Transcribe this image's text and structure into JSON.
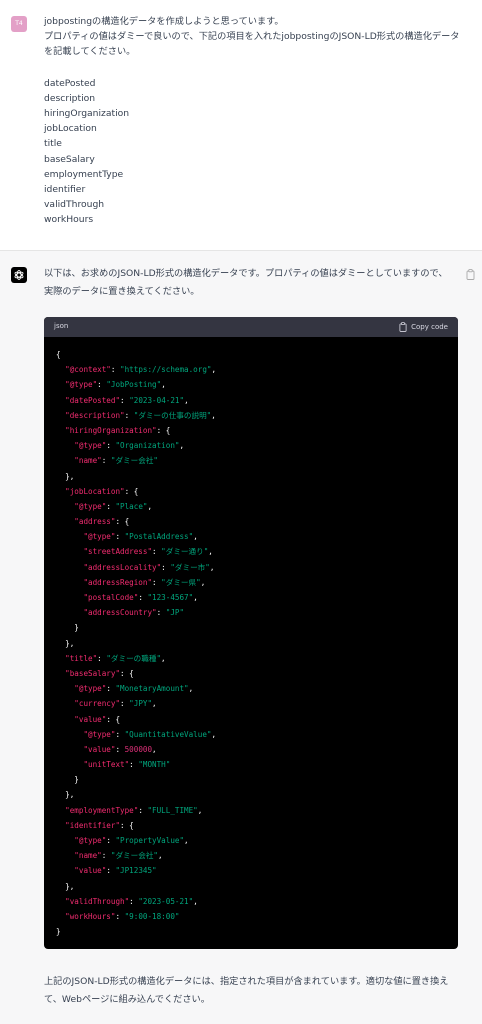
{
  "user": {
    "avatar_text": "T4",
    "message_line1": "jobpostingの構造化データを作成しようと思っています。",
    "message_line2": "プロパティの値はダミーで良いので、下記の項目を入れたjobpostingのJSON-LD形式の構造化データを記載してください。",
    "fields": [
      "datePosted",
      "description",
      "hiringOrganization",
      "jobLocation",
      "title",
      "baseSalary",
      "employmentType",
      "identifier",
      "validThrough",
      "workHours"
    ]
  },
  "assistant": {
    "intro": "以下は、お求めのJSON-LD形式の構造化データです。プロパティの値はダミーとしていますので、実際のデータに置き換えてください。",
    "code_language": "json",
    "copy_code_label": "Copy code",
    "outro": "上記のJSON-LD形式の構造化データには、指定された項目が含まれています。適切な値に置き換えて、Webページに組み込んでください。",
    "code_lines": [
      [
        {
          "t": "p",
          "v": "{"
        }
      ],
      [
        {
          "t": "p",
          "v": "  "
        },
        {
          "t": "k",
          "v": "\"@context\""
        },
        {
          "t": "p",
          "v": ": "
        },
        {
          "t": "s",
          "v": "\"https://schema.org\""
        },
        {
          "t": "p",
          "v": ","
        }
      ],
      [
        {
          "t": "p",
          "v": "  "
        },
        {
          "t": "k",
          "v": "\"@type\""
        },
        {
          "t": "p",
          "v": ": "
        },
        {
          "t": "s",
          "v": "\"JobPosting\""
        },
        {
          "t": "p",
          "v": ","
        }
      ],
      [
        {
          "t": "p",
          "v": "  "
        },
        {
          "t": "k",
          "v": "\"datePosted\""
        },
        {
          "t": "p",
          "v": ": "
        },
        {
          "t": "s",
          "v": "\"2023-04-21\""
        },
        {
          "t": "p",
          "v": ","
        }
      ],
      [
        {
          "t": "p",
          "v": "  "
        },
        {
          "t": "k",
          "v": "\"description\""
        },
        {
          "t": "p",
          "v": ": "
        },
        {
          "t": "s",
          "v": "\"ダミーの仕事の説明\""
        },
        {
          "t": "p",
          "v": ","
        }
      ],
      [
        {
          "t": "p",
          "v": "  "
        },
        {
          "t": "k",
          "v": "\"hiringOrganization\""
        },
        {
          "t": "p",
          "v": ": {"
        }
      ],
      [
        {
          "t": "p",
          "v": "    "
        },
        {
          "t": "k",
          "v": "\"@type\""
        },
        {
          "t": "p",
          "v": ": "
        },
        {
          "t": "s",
          "v": "\"Organization\""
        },
        {
          "t": "p",
          "v": ","
        }
      ],
      [
        {
          "t": "p",
          "v": "    "
        },
        {
          "t": "k",
          "v": "\"name\""
        },
        {
          "t": "p",
          "v": ": "
        },
        {
          "t": "s",
          "v": "\"ダミー会社\""
        }
      ],
      [
        {
          "t": "p",
          "v": "  },"
        }
      ],
      [
        {
          "t": "p",
          "v": "  "
        },
        {
          "t": "k",
          "v": "\"jobLocation\""
        },
        {
          "t": "p",
          "v": ": {"
        }
      ],
      [
        {
          "t": "p",
          "v": "    "
        },
        {
          "t": "k",
          "v": "\"@type\""
        },
        {
          "t": "p",
          "v": ": "
        },
        {
          "t": "s",
          "v": "\"Place\""
        },
        {
          "t": "p",
          "v": ","
        }
      ],
      [
        {
          "t": "p",
          "v": "    "
        },
        {
          "t": "k",
          "v": "\"address\""
        },
        {
          "t": "p",
          "v": ": {"
        }
      ],
      [
        {
          "t": "p",
          "v": "      "
        },
        {
          "t": "k",
          "v": "\"@type\""
        },
        {
          "t": "p",
          "v": ": "
        },
        {
          "t": "s",
          "v": "\"PostalAddress\""
        },
        {
          "t": "p",
          "v": ","
        }
      ],
      [
        {
          "t": "p",
          "v": "      "
        },
        {
          "t": "k",
          "v": "\"streetAddress\""
        },
        {
          "t": "p",
          "v": ": "
        },
        {
          "t": "s",
          "v": "\"ダミー通り\""
        },
        {
          "t": "p",
          "v": ","
        }
      ],
      [
        {
          "t": "p",
          "v": "      "
        },
        {
          "t": "k",
          "v": "\"addressLocality\""
        },
        {
          "t": "p",
          "v": ": "
        },
        {
          "t": "s",
          "v": "\"ダミー市\""
        },
        {
          "t": "p",
          "v": ","
        }
      ],
      [
        {
          "t": "p",
          "v": "      "
        },
        {
          "t": "k",
          "v": "\"addressRegion\""
        },
        {
          "t": "p",
          "v": ": "
        },
        {
          "t": "s",
          "v": "\"ダミー県\""
        },
        {
          "t": "p",
          "v": ","
        }
      ],
      [
        {
          "t": "p",
          "v": "      "
        },
        {
          "t": "k",
          "v": "\"postalCode\""
        },
        {
          "t": "p",
          "v": ": "
        },
        {
          "t": "s",
          "v": "\"123-4567\""
        },
        {
          "t": "p",
          "v": ","
        }
      ],
      [
        {
          "t": "p",
          "v": "      "
        },
        {
          "t": "k",
          "v": "\"addressCountry\""
        },
        {
          "t": "p",
          "v": ": "
        },
        {
          "t": "s",
          "v": "\"JP\""
        }
      ],
      [
        {
          "t": "p",
          "v": "    }"
        }
      ],
      [
        {
          "t": "p",
          "v": "  },"
        }
      ],
      [
        {
          "t": "p",
          "v": "  "
        },
        {
          "t": "k",
          "v": "\"title\""
        },
        {
          "t": "p",
          "v": ": "
        },
        {
          "t": "s",
          "v": "\"ダミーの職種\""
        },
        {
          "t": "p",
          "v": ","
        }
      ],
      [
        {
          "t": "p",
          "v": "  "
        },
        {
          "t": "k",
          "v": "\"baseSalary\""
        },
        {
          "t": "p",
          "v": ": {"
        }
      ],
      [
        {
          "t": "p",
          "v": "    "
        },
        {
          "t": "k",
          "v": "\"@type\""
        },
        {
          "t": "p",
          "v": ": "
        },
        {
          "t": "s",
          "v": "\"MonetaryAmount\""
        },
        {
          "t": "p",
          "v": ","
        }
      ],
      [
        {
          "t": "p",
          "v": "    "
        },
        {
          "t": "k",
          "v": "\"currency\""
        },
        {
          "t": "p",
          "v": ": "
        },
        {
          "t": "s",
          "v": "\"JPY\""
        },
        {
          "t": "p",
          "v": ","
        }
      ],
      [
        {
          "t": "p",
          "v": "    "
        },
        {
          "t": "k",
          "v": "\"value\""
        },
        {
          "t": "p",
          "v": ": {"
        }
      ],
      [
        {
          "t": "p",
          "v": "      "
        },
        {
          "t": "k",
          "v": "\"@type\""
        },
        {
          "t": "p",
          "v": ": "
        },
        {
          "t": "s",
          "v": "\"QuantitativeValue\""
        },
        {
          "t": "p",
          "v": ","
        }
      ],
      [
        {
          "t": "p",
          "v": "      "
        },
        {
          "t": "k",
          "v": "\"value\""
        },
        {
          "t": "p",
          "v": ": "
        },
        {
          "t": "n",
          "v": "500000"
        },
        {
          "t": "p",
          "v": ","
        }
      ],
      [
        {
          "t": "p",
          "v": "      "
        },
        {
          "t": "k",
          "v": "\"unitText\""
        },
        {
          "t": "p",
          "v": ": "
        },
        {
          "t": "s",
          "v": "\"MONTH\""
        }
      ],
      [
        {
          "t": "p",
          "v": "    }"
        }
      ],
      [
        {
          "t": "p",
          "v": "  },"
        }
      ],
      [
        {
          "t": "p",
          "v": "  "
        },
        {
          "t": "k",
          "v": "\"employmentType\""
        },
        {
          "t": "p",
          "v": ": "
        },
        {
          "t": "s",
          "v": "\"FULL_TIME\""
        },
        {
          "t": "p",
          "v": ","
        }
      ],
      [
        {
          "t": "p",
          "v": "  "
        },
        {
          "t": "k",
          "v": "\"identifier\""
        },
        {
          "t": "p",
          "v": ": {"
        }
      ],
      [
        {
          "t": "p",
          "v": "    "
        },
        {
          "t": "k",
          "v": "\"@type\""
        },
        {
          "t": "p",
          "v": ": "
        },
        {
          "t": "s",
          "v": "\"PropertyValue\""
        },
        {
          "t": "p",
          "v": ","
        }
      ],
      [
        {
          "t": "p",
          "v": "    "
        },
        {
          "t": "k",
          "v": "\"name\""
        },
        {
          "t": "p",
          "v": ": "
        },
        {
          "t": "s",
          "v": "\"ダミー会社\""
        },
        {
          "t": "p",
          "v": ","
        }
      ],
      [
        {
          "t": "p",
          "v": "    "
        },
        {
          "t": "k",
          "v": "\"value\""
        },
        {
          "t": "p",
          "v": ": "
        },
        {
          "t": "s",
          "v": "\"JP12345\""
        }
      ],
      [
        {
          "t": "p",
          "v": "  },"
        }
      ],
      [
        {
          "t": "p",
          "v": "  "
        },
        {
          "t": "k",
          "v": "\"validThrough\""
        },
        {
          "t": "p",
          "v": ": "
        },
        {
          "t": "s",
          "v": "\"2023-05-21\""
        },
        {
          "t": "p",
          "v": ","
        }
      ],
      [
        {
          "t": "p",
          "v": "  "
        },
        {
          "t": "k",
          "v": "\"workHours\""
        },
        {
          "t": "p",
          "v": ": "
        },
        {
          "t": "s",
          "v": "\"9:00-18:00\""
        }
      ],
      [
        {
          "t": "p",
          "v": "}"
        }
      ]
    ]
  },
  "colors": {
    "key": "#f22c70",
    "string": "#00a67d",
    "number": "#df3079",
    "user_avatar": "#e3a0c7",
    "code_header": "#343541",
    "assistant_bg": "#f7f7f8"
  },
  "icons": {
    "assistant_avatar": "openai-logo-icon",
    "copy_message": "clipboard-icon",
    "copy_code": "clipboard-icon"
  }
}
